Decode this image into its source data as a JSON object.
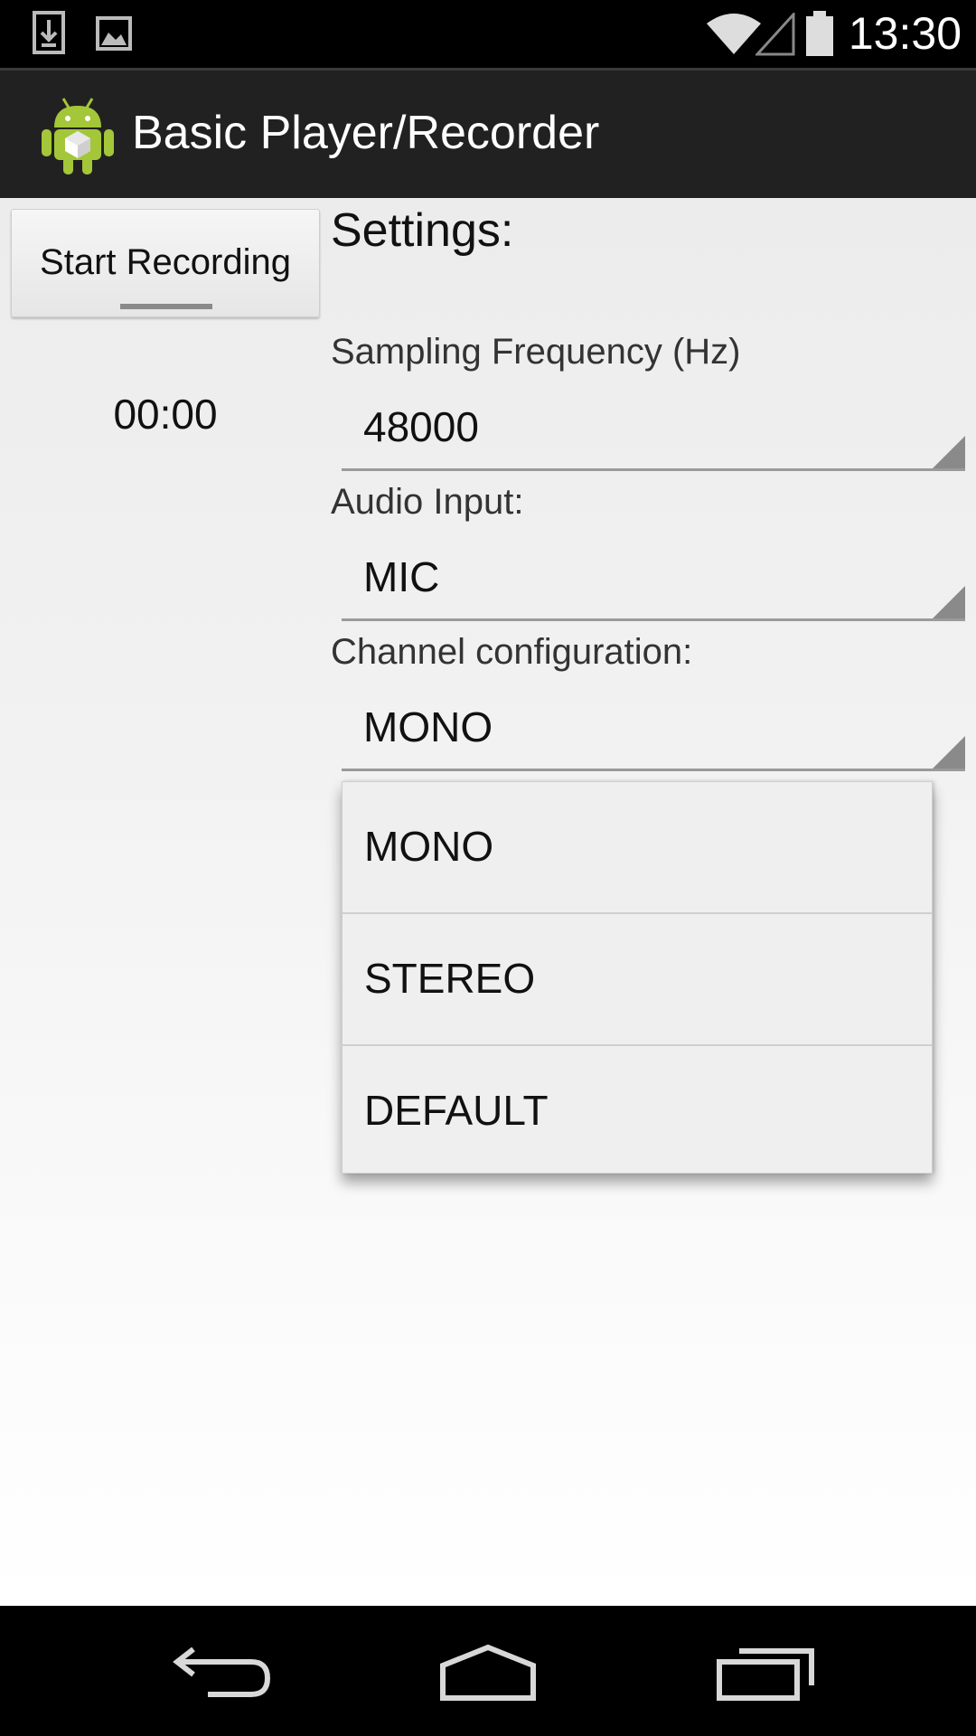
{
  "status_bar": {
    "time": "13:30",
    "icons": [
      "download-icon",
      "image-icon",
      "wifi-icon",
      "signal-icon",
      "battery-icon"
    ]
  },
  "action_bar": {
    "title": "Basic Player/Recorder",
    "app_icon": "android-app-icon"
  },
  "recorder": {
    "button_label": "Start Recording",
    "timer": "00:00"
  },
  "settings": {
    "title": "Settings:",
    "sampling_frequency": {
      "label": "Sampling Frequency (Hz)",
      "value": "48000"
    },
    "audio_input": {
      "label": "Audio Input:",
      "value": "MIC"
    },
    "channel_configuration": {
      "label": "Channel configuration:",
      "value": "MONO",
      "options": [
        "MONO",
        "STEREO",
        "DEFAULT"
      ]
    }
  },
  "nav_bar": {
    "icons": [
      "back-icon",
      "home-icon",
      "recents-icon"
    ]
  },
  "colors": {
    "status_bar": "#000000",
    "action_bar": "#212121",
    "android_green": "#a4c639"
  }
}
